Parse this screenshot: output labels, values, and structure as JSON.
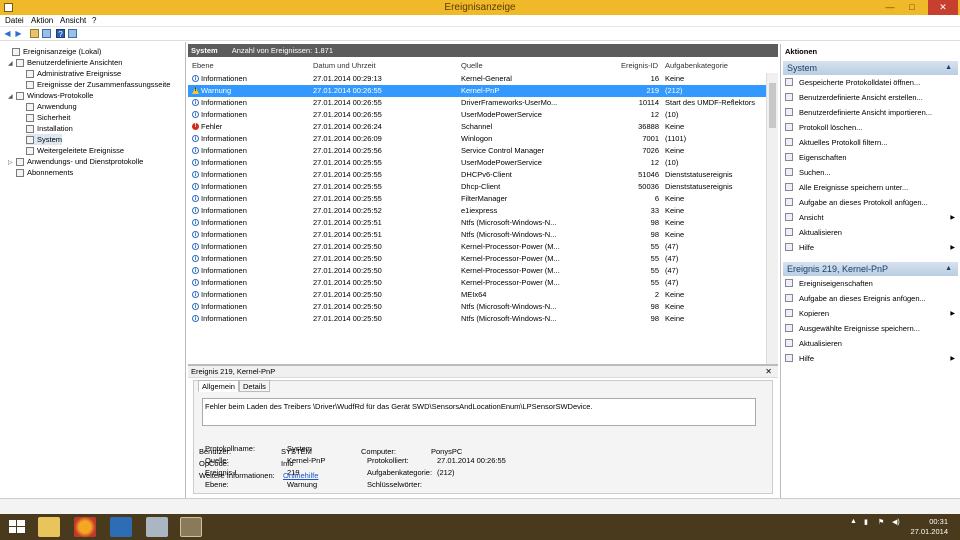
{
  "window": {
    "title": "Ereignisanzeige",
    "minimize": "—",
    "maximize": "□",
    "close": "✕"
  },
  "menu": [
    "Datei",
    "Aktion",
    "Ansicht",
    "?"
  ],
  "tree": [
    {
      "label": "Ereignisanzeige (Lokal)",
      "expander": ""
    },
    {
      "label": "Benutzerdefinierte Ansichten",
      "expander": "◢"
    },
    {
      "label": "Administrative Ereignisse",
      "expander": ""
    },
    {
      "label": "Ereignisse der Zusammenfassungsseite",
      "expander": ""
    },
    {
      "label": "Windows-Protokolle",
      "expander": "◢"
    },
    {
      "label": "Anwendung",
      "expander": ""
    },
    {
      "label": "Sicherheit",
      "expander": ""
    },
    {
      "label": "Installation",
      "expander": ""
    },
    {
      "label": "System",
      "expander": ""
    },
    {
      "label": "Weitergeleitete Ereignisse",
      "expander": ""
    },
    {
      "label": "Anwendungs- und Dienstprotokolle",
      "expander": "▷"
    },
    {
      "label": "Abonnements",
      "expander": ""
    }
  ],
  "list": {
    "name": "System",
    "count": "Anzahl von Ereignissen: 1.871",
    "columns": [
      "Ebene",
      "Datum und Uhrzeit",
      "Quelle",
      "Ereignis-ID",
      "Aufgabenkategorie"
    ],
    "rows": [
      {
        "level": "Informationen",
        "type": "info",
        "date": "27.01.2014 00:29:13",
        "source": "Kernel-General",
        "id": "16",
        "cat": "Keine"
      },
      {
        "level": "Warnung",
        "type": "warn",
        "date": "27.01.2014 00:26:55",
        "source": "Kernel-PnP",
        "id": "219",
        "cat": "(212)",
        "selected": true
      },
      {
        "level": "Informationen",
        "type": "info",
        "date": "27.01.2014 00:26:55",
        "source": "DriverFrameworks-UserMo...",
        "id": "10114",
        "cat": "Start des UMDF-Reflektors"
      },
      {
        "level": "Informationen",
        "type": "info",
        "date": "27.01.2014 00:26:55",
        "source": "UserModePowerService",
        "id": "12",
        "cat": "(10)"
      },
      {
        "level": "Fehler",
        "type": "err",
        "date": "27.01.2014 00:26:24",
        "source": "Schannel",
        "id": "36888",
        "cat": "Keine"
      },
      {
        "level": "Informationen",
        "type": "info",
        "date": "27.01.2014 00:26:09",
        "source": "Winlogon",
        "id": "7001",
        "cat": "(1101)"
      },
      {
        "level": "Informationen",
        "type": "info",
        "date": "27.01.2014 00:25:56",
        "source": "Service Control Manager",
        "id": "7026",
        "cat": "Keine"
      },
      {
        "level": "Informationen",
        "type": "info",
        "date": "27.01.2014 00:25:55",
        "source": "UserModePowerService",
        "id": "12",
        "cat": "(10)"
      },
      {
        "level": "Informationen",
        "type": "info",
        "date": "27.01.2014 00:25:55",
        "source": "DHCPv6-Client",
        "id": "51046",
        "cat": "Dienststatusereignis"
      },
      {
        "level": "Informationen",
        "type": "info",
        "date": "27.01.2014 00:25:55",
        "source": "Dhcp-Client",
        "id": "50036",
        "cat": "Dienststatusereignis"
      },
      {
        "level": "Informationen",
        "type": "info",
        "date": "27.01.2014 00:25:55",
        "source": "FilterManager",
        "id": "6",
        "cat": "Keine"
      },
      {
        "level": "Informationen",
        "type": "info",
        "date": "27.01.2014 00:25:52",
        "source": "e1iexpress",
        "id": "33",
        "cat": "Keine"
      },
      {
        "level": "Informationen",
        "type": "info",
        "date": "27.01.2014 00:25:51",
        "source": "Ntfs (Microsoft-Windows-N...",
        "id": "98",
        "cat": "Keine"
      },
      {
        "level": "Informationen",
        "type": "info",
        "date": "27.01.2014 00:25:51",
        "source": "Ntfs (Microsoft-Windows-N...",
        "id": "98",
        "cat": "Keine"
      },
      {
        "level": "Informationen",
        "type": "info",
        "date": "27.01.2014 00:25:50",
        "source": "Kernel-Processor-Power (M...",
        "id": "55",
        "cat": "(47)"
      },
      {
        "level": "Informationen",
        "type": "info",
        "date": "27.01.2014 00:25:50",
        "source": "Kernel-Processor-Power (M...",
        "id": "55",
        "cat": "(47)"
      },
      {
        "level": "Informationen",
        "type": "info",
        "date": "27.01.2014 00:25:50",
        "source": "Kernel-Processor-Power (M...",
        "id": "55",
        "cat": "(47)"
      },
      {
        "level": "Informationen",
        "type": "info",
        "date": "27.01.2014 00:25:50",
        "source": "Kernel-Processor-Power (M...",
        "id": "55",
        "cat": "(47)"
      },
      {
        "level": "Informationen",
        "type": "info",
        "date": "27.01.2014 00:25:50",
        "source": "MEIx64",
        "id": "2",
        "cat": "Keine"
      },
      {
        "level": "Informationen",
        "type": "info",
        "date": "27.01.2014 00:25:50",
        "source": "Ntfs (Microsoft-Windows-N...",
        "id": "98",
        "cat": "Keine"
      },
      {
        "level": "Informationen",
        "type": "info",
        "date": "27.01.2014 00:25:50",
        "source": "Ntfs (Microsoft-Windows-N...",
        "id": "98",
        "cat": "Keine"
      }
    ]
  },
  "detail": {
    "header": "Ereignis 219, Kernel-PnP",
    "close": "✕",
    "tabs": [
      "Allgemein",
      "Details"
    ],
    "message": "Fehler beim Laden des Treibers \\Driver\\WudfRd für das Gerät SWD\\SensorsAndLocationEnum\\LPSensorSWDevice.",
    "props": {
      "protokollname_label": "Protokollname:",
      "protokollname": "System",
      "quelle_label": "Quelle:",
      "quelle": "Kernel-PnP",
      "protokolliert_label": "Protokolliert:",
      "protokolliert": "27.01.2014 00:26:55",
      "ereignis_label": "Ereignis-I",
      "ereignis": "219",
      "aufgabe_label": "Aufgabenkategorie:",
      "aufgabe": "(212)",
      "ebene_label": "Ebene:",
      "ebene": "Warnung",
      "schluessel_label": "Schlüsselwörter:",
      "benutzer_label": "Benutzer:",
      "benutzer": "SYSTEM",
      "computer_label": "Computer:",
      "computer": "PonysPC",
      "opcode_label": "OpCode:",
      "opcode": "Info",
      "weitere_label": "Weitere Informationen:",
      "weitere_link": "Onlinehilfe"
    }
  },
  "actions": {
    "header": "Aktionen",
    "section1": "System",
    "items1": [
      {
        "label": "Gespeicherte Protokolldatei öffnen...",
        "sub": ""
      },
      {
        "label": "Benutzerdefinierte Ansicht erstellen...",
        "sub": ""
      },
      {
        "label": "Benutzerdefinierte Ansicht importieren...",
        "sub": ""
      },
      {
        "label": "Protokoll löschen...",
        "sub": ""
      },
      {
        "label": "Aktuelles Protokoll filtern...",
        "sub": ""
      },
      {
        "label": "Eigenschaften",
        "sub": ""
      },
      {
        "label": "Suchen...",
        "sub": ""
      },
      {
        "label": "Alle Ereignisse speichern unter...",
        "sub": ""
      },
      {
        "label": "Aufgabe an dieses Protokoll anfügen...",
        "sub": ""
      },
      {
        "label": "Ansicht",
        "sub": "▶"
      },
      {
        "label": "Aktualisieren",
        "sub": ""
      },
      {
        "label": "Hilfe",
        "sub": "▶"
      }
    ],
    "section2": "Ereignis 219, Kernel-PnP",
    "items2": [
      {
        "label": "Ereigniseigenschaften",
        "sub": ""
      },
      {
        "label": "Aufgabe an dieses Ereignis anfügen...",
        "sub": ""
      },
      {
        "label": "Kopieren",
        "sub": "▶"
      },
      {
        "label": "Ausgewählte Ereignisse speichern...",
        "sub": ""
      },
      {
        "label": "Aktualisieren",
        "sub": ""
      },
      {
        "label": "Hilfe",
        "sub": "▶"
      }
    ]
  },
  "taskbar": {
    "time": "00:31",
    "date": "27.01.2014"
  },
  "colors": {
    "titlebar": "#f0b92a",
    "selection": "#3399ff",
    "taskbar": "#4a3a1d",
    "section": "#b9cde3"
  }
}
